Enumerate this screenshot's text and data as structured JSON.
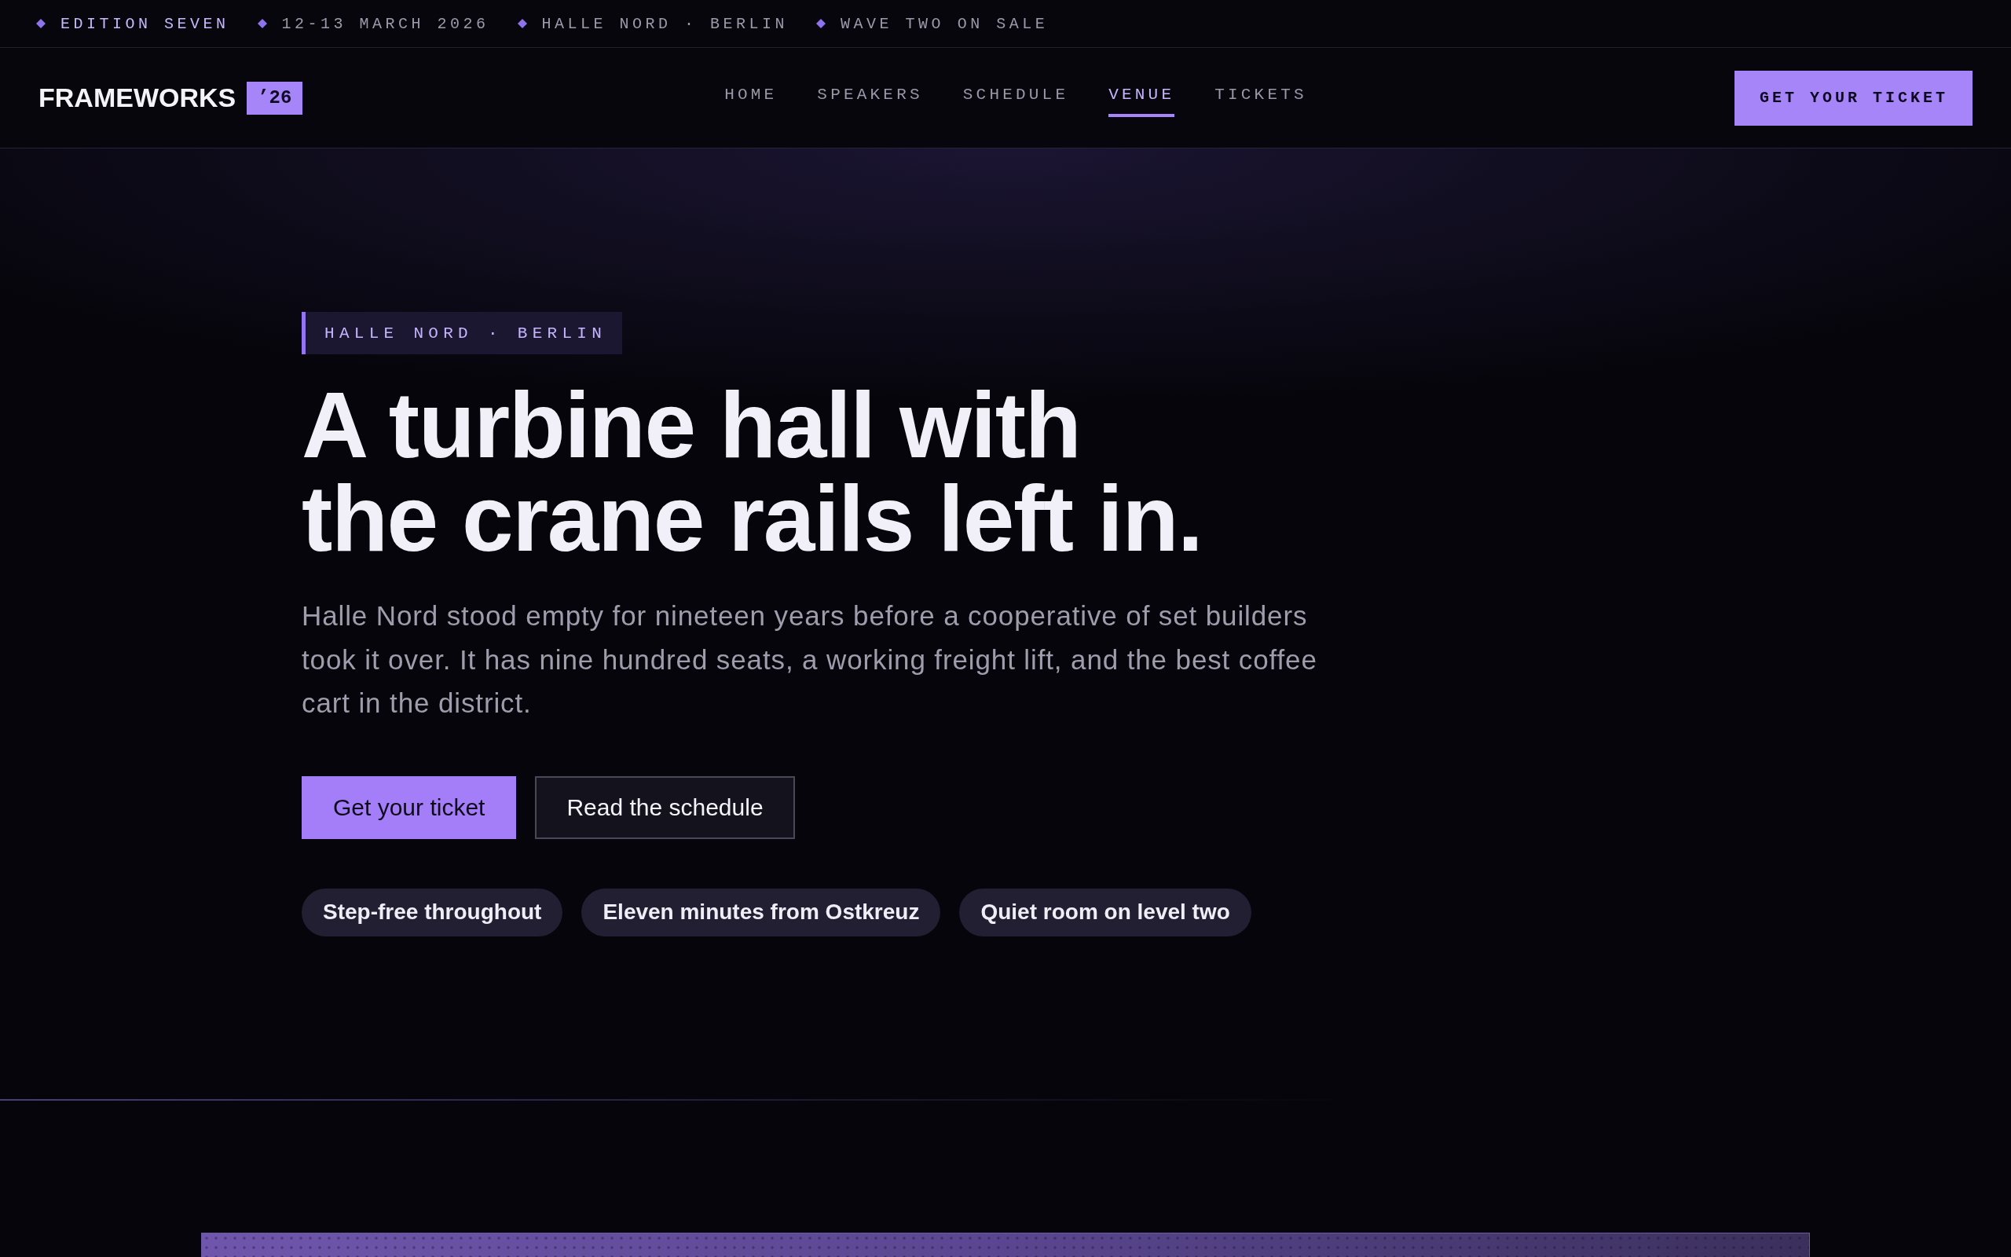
{
  "announcement_bar": {
    "items": [
      {
        "text": "EDITION SEVEN",
        "highlighted": true
      },
      {
        "text": "12-13 MARCH 2026",
        "highlighted": false
      },
      {
        "text": "HALLE NORD · BERLIN",
        "highlighted": false
      },
      {
        "text": "WAVE TWO ON SALE",
        "highlighted": false
      }
    ]
  },
  "nav": {
    "logo": "FRAMEWORKS",
    "logo_badge": "’26",
    "links": [
      {
        "label": "HOME",
        "selected": false
      },
      {
        "label": "SPEAKERS",
        "selected": false
      },
      {
        "label": "SCHEDULE",
        "selected": false
      },
      {
        "label": "VENUE",
        "selected": true
      },
      {
        "label": "TICKETS",
        "selected": false
      }
    ],
    "cta": "GET YOUR TICKET"
  },
  "hero": {
    "eyebrow": "HALLE NORD · BERLIN",
    "title": "A turbine hall with the crane rails left in.",
    "body": "Halle Nord stood empty for nineteen years before a cooperative of set builders took it over. It has nine hundred seats, a working freight lift, and the best coffee cart in the district.",
    "buttons": [
      {
        "label": "Get your ticket",
        "kind": "primary"
      },
      {
        "label": "Read the schedule",
        "kind": "secondary"
      }
    ],
    "features": [
      "Step-free throughout",
      "Eleven minutes from Ostkreuz",
      "Quiet room on level two"
    ]
  }
}
